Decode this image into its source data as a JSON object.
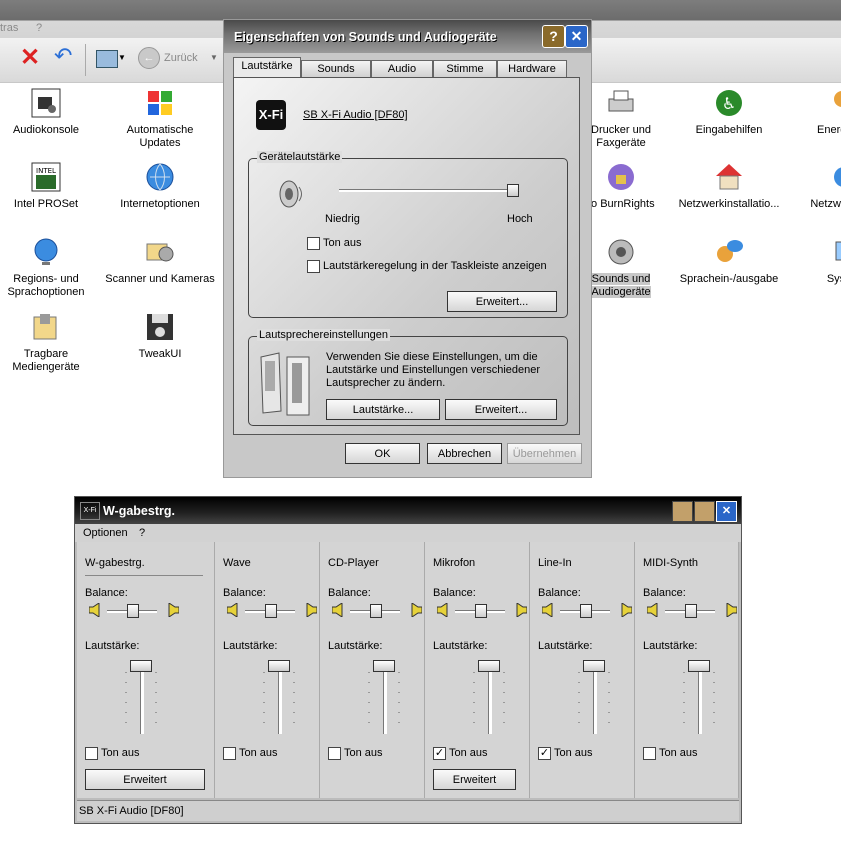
{
  "explorer": {
    "menu_items": [
      "tras",
      "?"
    ],
    "toolbar": {
      "back_label": "Zurück"
    },
    "icons": [
      {
        "label": "Audiokonsole"
      },
      {
        "label": "Automatische Updates"
      },
      {
        "label": "Drucker und Faxgeräte"
      },
      {
        "label": "Eingabehilfen"
      },
      {
        "label": "Energie"
      },
      {
        "label": "Intel PROSet"
      },
      {
        "label": "Internetoptionen"
      },
      {
        "label": "ro BurnRights"
      },
      {
        "label": "Netzwerkinstallatio..."
      },
      {
        "label": "Netzwerkv"
      },
      {
        "label": "Regions- und Sprachoptionen"
      },
      {
        "label": "Scanner und Kameras"
      },
      {
        "label": "Sounds und Audiogeräte"
      },
      {
        "label": "Sprachein-/ausgabe"
      },
      {
        "label": "Sys"
      },
      {
        "label": "Tragbare Mediengeräte"
      },
      {
        "label": "TweakUI"
      }
    ]
  },
  "sound_dialog": {
    "title": "Eigenschaften von Sounds und Audiogeräte",
    "tabs": [
      "Lautstärke",
      "Sounds",
      "Audio",
      "Stimme",
      "Hardware"
    ],
    "device_name": "SB X-Fi Audio [DF80]",
    "device_volume": {
      "caption": "Gerätelautstärke",
      "low_label": "Niedrig",
      "high_label": "Hoch",
      "level": 1.0,
      "mute_label": "Ton aus",
      "taskbar_label": "Lautstärkeregelung in der Taskleiste anzeigen",
      "advanced_label": "Erweitert..."
    },
    "speakers": {
      "caption": "Lautsprechereinstellungen",
      "description": "Verwenden Sie diese Einstellungen, um die Lautstärke und Einstellungen verschiedener Lautsprecher zu ändern.",
      "volume_button": "Lautstärke...",
      "advanced_button": "Erweitert..."
    },
    "buttons": {
      "ok": "OK",
      "cancel": "Abbrechen",
      "apply": "Übernehmen"
    }
  },
  "mixer": {
    "title": "W-gabestrg.",
    "menu": [
      "Optionen",
      "?"
    ],
    "balance_label": "Balance:",
    "volume_label": "Lautstärke:",
    "mute_label": "Ton aus",
    "advanced_label": "Erweitert",
    "channels": [
      {
        "name": "W-gabestrg.",
        "muted": false,
        "advanced": true
      },
      {
        "name": "Wave",
        "muted": false,
        "advanced": false
      },
      {
        "name": "CD-Player",
        "muted": false,
        "advanced": false
      },
      {
        "name": "Mikrofon",
        "muted": true,
        "advanced": true
      },
      {
        "name": "Line-In",
        "muted": true,
        "advanced": false
      },
      {
        "name": "MIDI-Synth",
        "muted": false,
        "advanced": false
      }
    ],
    "status": "SB X-Fi Audio [DF80]"
  }
}
